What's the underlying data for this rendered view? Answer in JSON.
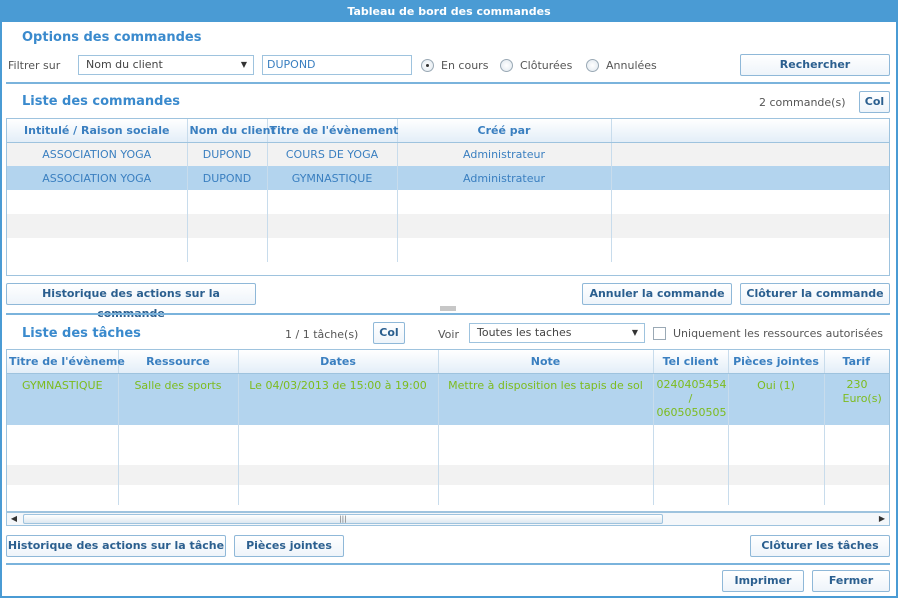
{
  "window": {
    "title": "Tableau de bord des commandes"
  },
  "options": {
    "title": "Options des commandes",
    "filter_label": "Filtrer sur",
    "filter_select": "Nom du client",
    "filter_value": "DUPOND",
    "radios": [
      {
        "label": "En cours",
        "checked": true
      },
      {
        "label": "Clôturées",
        "checked": false
      },
      {
        "label": "Annulées",
        "checked": false
      }
    ],
    "search_button": "Rechercher"
  },
  "orders": {
    "title": "Liste des commandes",
    "count": "2 commande(s)",
    "col_button": "Col",
    "columns": [
      "Intitulé / Raison sociale",
      "Nom du client",
      "Titre de l'évènement",
      "Créé par",
      ""
    ],
    "rows": [
      [
        "ASSOCIATION YOGA",
        "DUPOND",
        "COURS DE YOGA",
        "Administrateur",
        ""
      ],
      [
        "ASSOCIATION YOGA",
        "DUPOND",
        "GYMNASTIQUE",
        "Administrateur",
        ""
      ]
    ],
    "history_button": "Historique des actions sur la commande",
    "cancel_button": "Annuler la commande",
    "close_button": "Clôturer la commande"
  },
  "tasks": {
    "title": "Liste des tâches",
    "count": "1 / 1 tâche(s)",
    "col_button": "Col",
    "view_label": "Voir",
    "view_select": "Toutes les taches",
    "authorized_only": "Uniquement les ressources autorisées",
    "columns": [
      "Titre de l'évèneme",
      "Ressource",
      "Dates",
      "Note",
      "Tel client",
      "Pièces jointes",
      "Tarif"
    ],
    "rows": [
      {
        "title": "GYMNASTIQUE",
        "resource": "Salle des sports",
        "dates": "Le 04/03/2013 de 15:00 à 19:00",
        "note": "Mettre à disposition les tapis de sol",
        "tel1": "0240405454",
        "tel_sep": "/",
        "tel2": "0605050505",
        "attachments": "Oui (1)",
        "price1": "230",
        "price2": "Euro(s)"
      }
    ],
    "history_button": "Historique des actions sur la tâche",
    "attachments_button": "Pièces jointes",
    "close_button": "Clôturer les tâches"
  },
  "footer": {
    "print_button": "Imprimer",
    "close_button": "Fermer"
  },
  "colors": {
    "accent": "#4a9bd4",
    "selected_row": "#b3d4ee",
    "task_text": "#7dbb1e",
    "order_text": "#3a7fc0"
  }
}
